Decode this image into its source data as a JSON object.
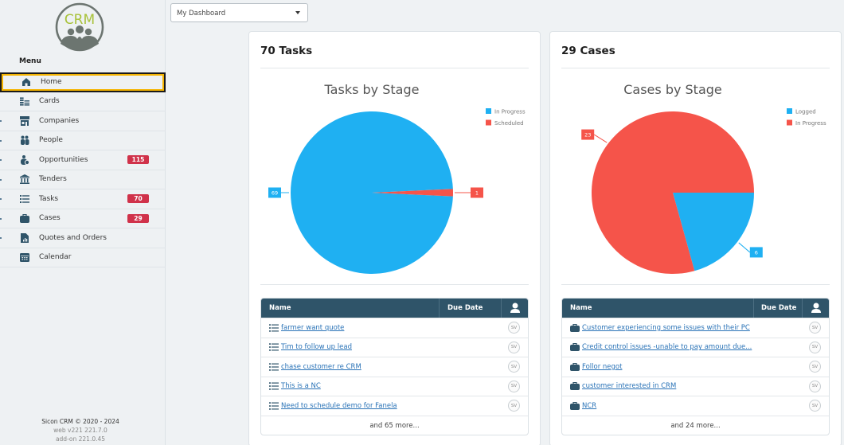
{
  "sidebar": {
    "logo_text": "CRM",
    "menu_title": "Menu",
    "items": [
      {
        "label": "Home",
        "icon": "home-icon",
        "active": true
      },
      {
        "label": "Cards",
        "icon": "cards-icon"
      },
      {
        "label": "Companies",
        "icon": "companies-icon"
      },
      {
        "label": "People",
        "icon": "people-icon"
      },
      {
        "label": "Opportunities",
        "icon": "opportunities-icon",
        "badge": "115"
      },
      {
        "label": "Tenders",
        "icon": "tenders-icon"
      },
      {
        "label": "Tasks",
        "icon": "tasks-icon",
        "badge": "70"
      },
      {
        "label": "Cases",
        "icon": "cases-icon",
        "badge": "29"
      },
      {
        "label": "Quotes and Orders",
        "icon": "quotes-icon"
      },
      {
        "label": "Calendar",
        "icon": "calendar-icon"
      }
    ],
    "footer": {
      "copyright": "Sicon CRM © 2020 - 2024",
      "web_version": "web v221 221.7.0",
      "addon_version": "add-on 221.0.45"
    }
  },
  "dashboard_select": {
    "value": "My Dashboard"
  },
  "colors": {
    "blue": "#1fb0f2",
    "red": "#f5544a",
    "header": "#2f5469",
    "badge": "#d0324a",
    "link": "#2a73b7"
  },
  "tasks_card": {
    "title": "70 Tasks",
    "table": {
      "columns": [
        "Name",
        "Due Date"
      ],
      "user_icon": "user-icon",
      "rows": [
        {
          "name": "farmer want quote",
          "due": "",
          "user": "SV"
        },
        {
          "name": "Tim to follow up lead",
          "due": "",
          "user": "SV"
        },
        {
          "name": "chase customer re CRM",
          "due": "",
          "user": "SV"
        },
        {
          "name": "This is a NC",
          "due": "",
          "user": "SV"
        },
        {
          "name": "Need to schedule demo for Fanela",
          "due": "",
          "user": "SV"
        }
      ],
      "more": "and 65 more..."
    }
  },
  "cases_card": {
    "title": "29 Cases",
    "table": {
      "columns": [
        "Name",
        "Due Date"
      ],
      "user_icon": "user-icon",
      "rows": [
        {
          "name": "Customer experiencing some issues with their PC",
          "due": "",
          "user": "SV"
        },
        {
          "name": "Credit control issues -unable to pay amount due...",
          "due": "",
          "user": "SV"
        },
        {
          "name": "Follor negot",
          "due": "",
          "user": "SV"
        },
        {
          "name": "customer interested in CRM",
          "due": "",
          "user": "SV"
        },
        {
          "name": "NCR",
          "due": "",
          "user": "SV"
        }
      ],
      "more": "and 24 more..."
    }
  },
  "chart_data": [
    {
      "type": "pie",
      "title": "Tasks by Stage",
      "legend_position": "top-right",
      "slices": [
        {
          "label": "In Progress",
          "value": 69,
          "color": "#1fb0f2"
        },
        {
          "label": "Scheduled",
          "value": 1,
          "color": "#f5544a"
        }
      ]
    },
    {
      "type": "pie",
      "title": "Cases by Stage",
      "legend_position": "top-right",
      "slices": [
        {
          "label": "Logged",
          "value": 6,
          "color": "#1fb0f2"
        },
        {
          "label": "In Progress",
          "value": 23,
          "color": "#f5544a"
        }
      ]
    }
  ]
}
